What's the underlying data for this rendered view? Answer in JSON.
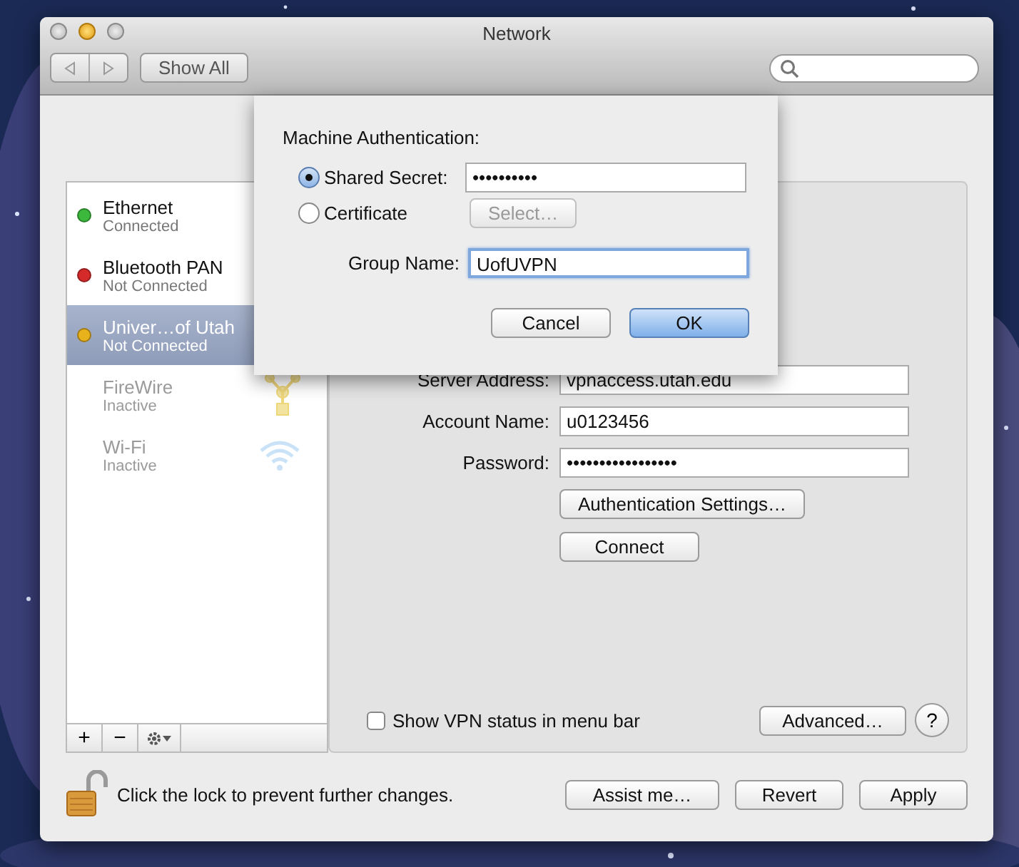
{
  "window": {
    "title": "Network"
  },
  "toolbar": {
    "show_all": "Show All"
  },
  "services": [
    {
      "name": "Ethernet",
      "status": "Connected",
      "color": "#3cb83c",
      "selected": false,
      "inactive": false,
      "kind": "ethernet"
    },
    {
      "name": "Bluetooth PAN",
      "status": "Not Connected",
      "color": "#d42a2a",
      "selected": false,
      "inactive": false,
      "kind": "bluetooth"
    },
    {
      "name": "Univer…of Utah",
      "status": "Not Connected",
      "color": "#e8b21c",
      "selected": true,
      "inactive": false,
      "kind": "vpn"
    },
    {
      "name": "FireWire",
      "status": "Inactive",
      "selected": false,
      "inactive": true,
      "kind": "firewire"
    },
    {
      "name": "Wi-Fi",
      "status": "Inactive",
      "selected": false,
      "inactive": true,
      "kind": "wifi"
    }
  ],
  "sidebar_buttons": [
    "+",
    "−"
  ],
  "vpn": {
    "fields": [
      {
        "label": "Server Address:",
        "value": "vpnaccess.utah.edu"
      },
      {
        "label": "Account Name:",
        "value": "u0123456"
      },
      {
        "label": "Password:",
        "value": "•••••••••••••••••"
      }
    ],
    "buttons": [
      "Authentication Settings…",
      "Connect"
    ],
    "show_status": {
      "label": "Show VPN status in menu bar",
      "checked": false
    },
    "advanced": "Advanced…",
    "help": "?"
  },
  "footer": {
    "lock_text": "Click the lock to prevent further changes.",
    "buttons": [
      "Assist me…",
      "Revert",
      "Apply"
    ]
  },
  "sheet": {
    "heading": "Machine Authentication:",
    "options": [
      {
        "label": "Shared Secret:",
        "selected": true,
        "kind": "field",
        "value": "••••••••••"
      },
      {
        "label": "Certificate",
        "selected": false,
        "kind": "button",
        "button": "Select…",
        "disabled": true
      }
    ],
    "group_name": {
      "label": "Group Name:",
      "value": "UofUVPN",
      "focused": true
    },
    "buttons": [
      {
        "label": "Cancel",
        "default": false
      },
      {
        "label": "OK",
        "default": true
      }
    ]
  }
}
